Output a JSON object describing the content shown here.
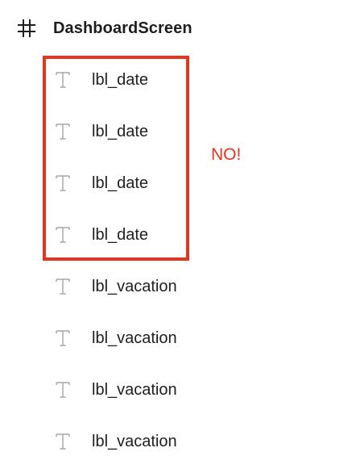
{
  "frame": {
    "icon": "hash-icon",
    "title": "DashboardScreen"
  },
  "layers": [
    {
      "icon": "text-icon",
      "label": "lbl_date"
    },
    {
      "icon": "text-icon",
      "label": "lbl_date"
    },
    {
      "icon": "text-icon",
      "label": "lbl_date"
    },
    {
      "icon": "text-icon",
      "label": "lbl_date"
    },
    {
      "icon": "text-icon",
      "label": "lbl_vacation"
    },
    {
      "icon": "text-icon",
      "label": "lbl_vacation"
    },
    {
      "icon": "text-icon",
      "label": "lbl_vacation"
    },
    {
      "icon": "text-icon",
      "label": "lbl_vacation"
    }
  ],
  "annotation": {
    "text": "NO!",
    "color": "#e8331f"
  }
}
